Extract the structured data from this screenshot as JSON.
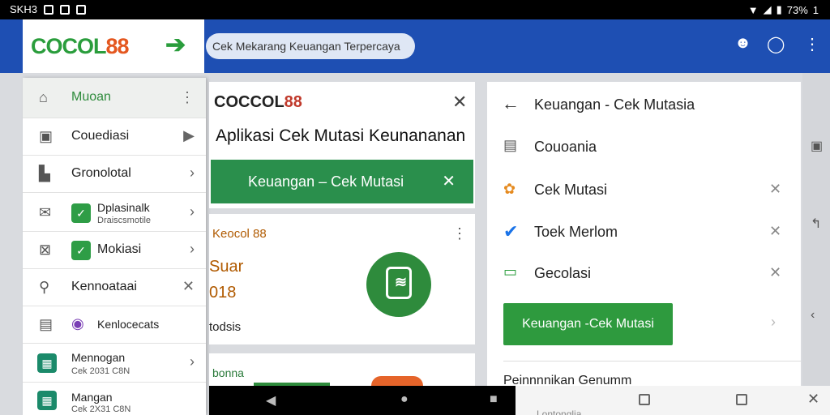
{
  "status_bar": {
    "left_text": "SKH3",
    "battery": "73%",
    "right_text": "1"
  },
  "app_bar": {
    "logo_part1": "COCOL",
    "logo_part2": "88",
    "search_text": "Cek Mekarang Keuangan Terpercaya",
    "colors": {
      "bar": "#1e4fb3",
      "brand_green": "#2a9d3c",
      "brand_orange": "#e4571f"
    }
  },
  "drawer": {
    "items": [
      {
        "label": "Muoan",
        "icon": "home-icon"
      },
      {
        "label": "Couediasi",
        "icon": "store-icon"
      },
      {
        "label": "Gronolotal",
        "icon": "upload-icon"
      },
      {
        "label": "Dplasinalk",
        "sub": "Draiscsmotile",
        "icon": "mail-icon"
      },
      {
        "label": "Mokiasi",
        "icon": "check-mail-icon"
      },
      {
        "label": "Kennoataai",
        "icon": "search-icon"
      },
      {
        "label": "Kenlocecats",
        "icon": "document-icon"
      },
      {
        "label": "Mennogan",
        "sub": "Cek 2031 C8N",
        "icon": "calendar-icon"
      },
      {
        "label": "Mangan",
        "sub": "Cek 2X31 C8N",
        "icon": "calendar-icon"
      }
    ]
  },
  "mid_card": {
    "logo_part1": "COCCOL",
    "logo_part2": "88",
    "title": "Aplikasi Cek Mutasi Keunananan",
    "banner": "Keuangan  –  Cek Mutasi"
  },
  "card2": {
    "title": "Keocol 88",
    "line1": "Suar",
    "line2": "018",
    "line3": "todsis"
  },
  "card3": {
    "title": "bonna"
  },
  "right_panel": {
    "title": "Keuangan - Cek Mutasia",
    "rows": [
      {
        "label": "Couoania",
        "icon": "receipt-icon"
      },
      {
        "label": "Cek Mutasi",
        "icon": "people-icon"
      },
      {
        "label": "Toek Merlom",
        "icon": "check-circle-icon"
      },
      {
        "label": "Gecolasi",
        "icon": "card-icon"
      }
    ],
    "button": "Keuangan -Cek Mutasi",
    "peek": "Peinnnnikan Genumm"
  },
  "nav_bar": {
    "ghost": "Lontonglia"
  }
}
